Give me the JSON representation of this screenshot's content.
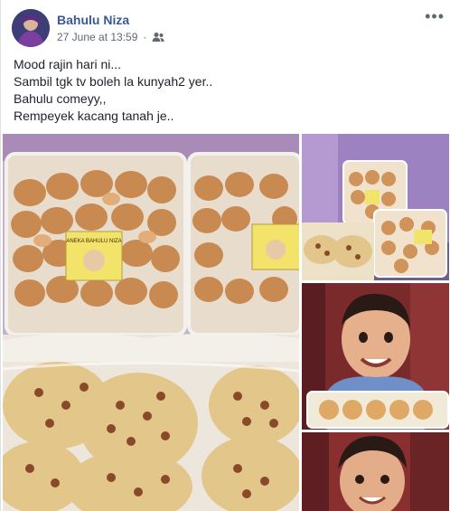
{
  "post": {
    "author": "Bahulu Niza",
    "timestamp": "27 June at 13:59",
    "audience_icon": "friends-icon",
    "more_icon": "more-options-icon",
    "more_label": "•••",
    "lines": [
      "Mood rajin hari ni...",
      "Sambil tgk tv boleh la kunyah2 yer..",
      "Bahulu comeyy,,",
      "Rempeyek kacang tanah je.."
    ]
  },
  "photos": {
    "count": 4,
    "labels": {
      "container_label": "ANEKA BAHULU NIZA"
    }
  }
}
